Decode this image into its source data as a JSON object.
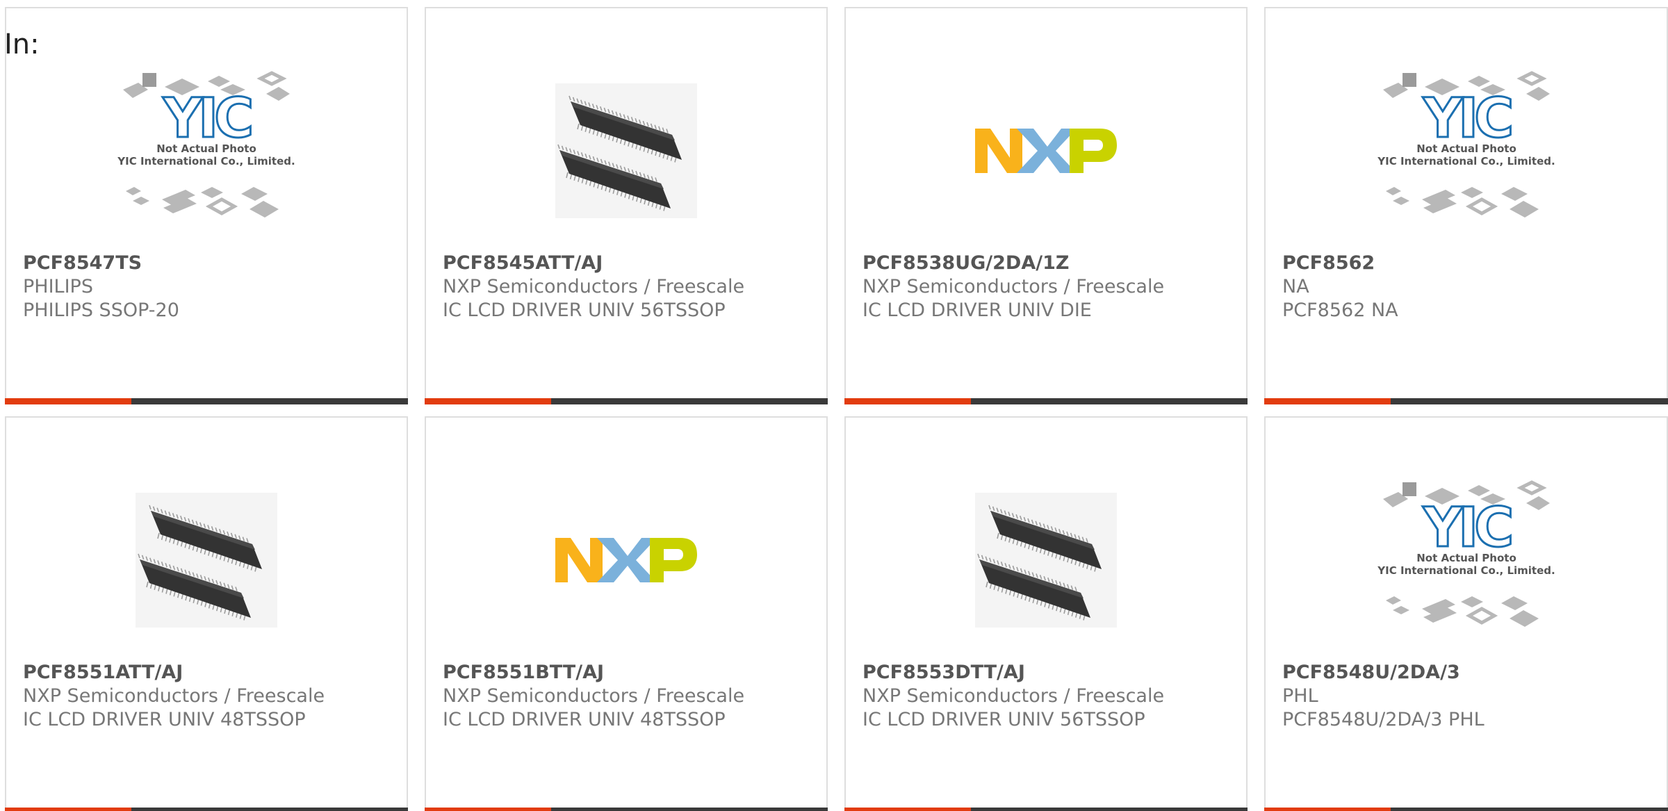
{
  "header": {
    "label": "In:"
  },
  "colors": {
    "accent": "#e23c0f",
    "bar": "#3a3a3a",
    "border": "#dedede",
    "text": "#777777"
  },
  "placeholder_image": {
    "line1": "Not Actual Photo",
    "line2": "YIC International Co., Limited.",
    "logo": "YIC"
  },
  "products": [
    {
      "part": "PCF8547TS",
      "manufacturer": "PHILIPS",
      "description": "PHILIPS SSOP-20",
      "image": "placeholder"
    },
    {
      "part": "PCF8545ATT/AJ",
      "manufacturer": "NXP Semiconductors / Freescale",
      "description": "IC LCD DRIVER UNIV 56TSSOP",
      "image": "tssop-chip"
    },
    {
      "part": "PCF8538UG/2DA/1Z",
      "manufacturer": "NXP Semiconductors / Freescale",
      "description": "IC LCD DRIVER UNIV DIE",
      "image": "nxp-logo"
    },
    {
      "part": "PCF8562",
      "manufacturer": "NA",
      "description": "PCF8562 NA",
      "image": "placeholder"
    },
    {
      "part": "PCF8551ATT/AJ",
      "manufacturer": "NXP Semiconductors / Freescale",
      "description": "IC LCD DRIVER UNIV 48TSSOP",
      "image": "tssop-chip"
    },
    {
      "part": "PCF8551BTT/AJ",
      "manufacturer": "NXP Semiconductors / Freescale",
      "description": "IC LCD DRIVER UNIV 48TSSOP",
      "image": "nxp-logo"
    },
    {
      "part": "PCF8553DTT/AJ",
      "manufacturer": "NXP Semiconductors / Freescale",
      "description": "IC LCD DRIVER UNIV 56TSSOP",
      "image": "tssop-chip"
    },
    {
      "part": "PCF8548U/2DA/3",
      "manufacturer": "PHL",
      "description": "PCF8548U/2DA/3 PHL",
      "image": "placeholder"
    }
  ]
}
